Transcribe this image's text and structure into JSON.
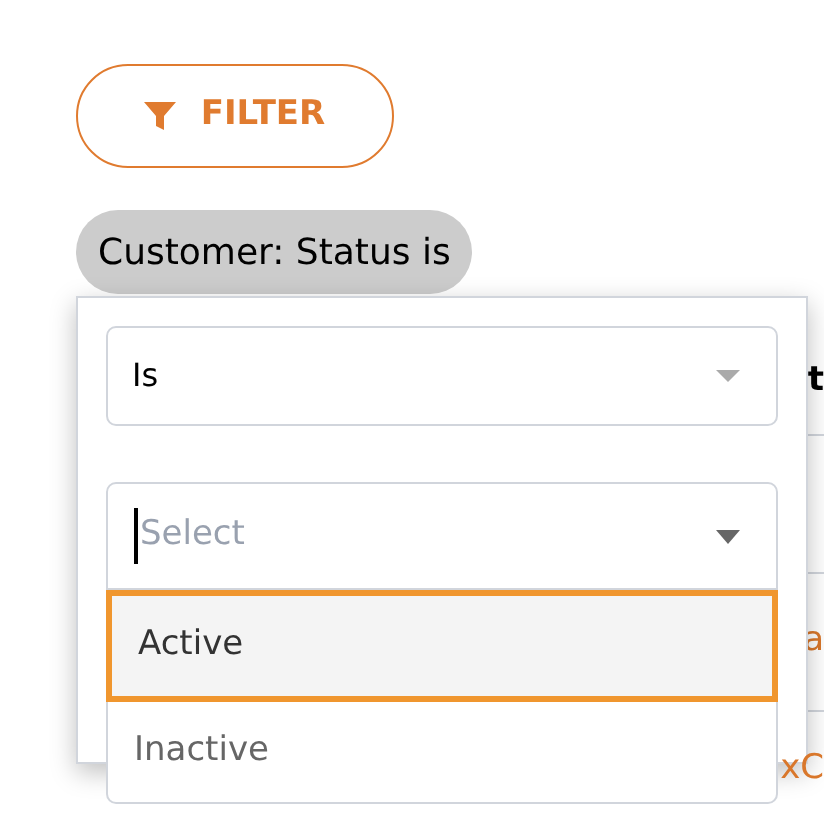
{
  "filter_button": {
    "label": "FILTER"
  },
  "filter_chip": {
    "label": "Customer: Status is"
  },
  "background_table": {
    "header": "t",
    "rows": [
      {
        "text": "a"
      },
      {
        "text": "xC"
      }
    ]
  },
  "popup": {
    "operator": {
      "value": "Is"
    },
    "value_select": {
      "placeholder": "Select",
      "focused": true
    },
    "options": [
      {
        "label": "Active",
        "selected": true
      },
      {
        "label": "Inactive",
        "selected": false
      }
    ]
  }
}
